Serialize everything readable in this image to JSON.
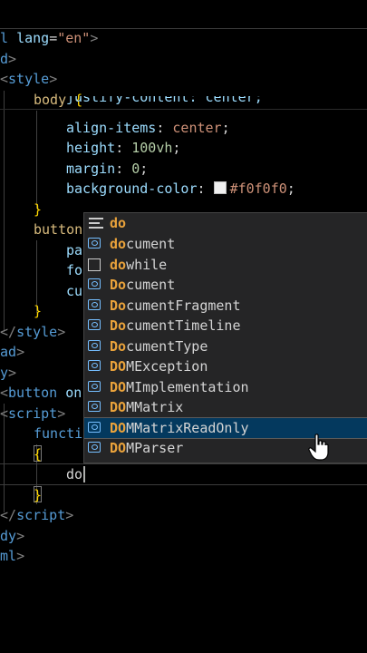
{
  "code": {
    "l1": {
      "a": "l",
      "b": "lang",
      "c": "=",
      "d": "\"en\"",
      "e": ">"
    },
    "l2": {
      "a": "d",
      "b": ">"
    },
    "l3": {
      "a": "<",
      "b": "style",
      "c": ">"
    },
    "l4": {
      "a": "body",
      "b": " {"
    },
    "l5": {
      "a": "justify-content: center;"
    },
    "l6": {
      "a": "align-items",
      "b": ": ",
      "c": "center",
      "d": ";"
    },
    "l7": {
      "a": "height",
      "b": ": ",
      "c": "100vh",
      "d": ";"
    },
    "l8": {
      "a": "margin",
      "b": ": ",
      "c": "0",
      "d": ";"
    },
    "l9": {
      "a": "background-color",
      "b": ": ",
      "c": "#f0f0f0",
      "d": ";"
    },
    "l10": {
      "a": "}"
    },
    "l11": {
      "a": "button"
    },
    "l12": {
      "a": "pa"
    },
    "l13": {
      "a": "fo"
    },
    "l14": {
      "a": "cu"
    },
    "l15": {
      "a": "}"
    },
    "l16": {
      "a": "</",
      "b": "style",
      "c": ">"
    },
    "l17": {
      "a": "ad",
      "b": ">"
    },
    "l18": {
      "a": "y",
      "b": ">"
    },
    "l19": {
      "a": "<",
      "b": "button",
      "c": " on"
    },
    "l20": {
      "a": "<",
      "b": "script",
      "c": ">"
    },
    "l21": {
      "a": "functi"
    },
    "l22": {
      "a": "{"
    },
    "l23": {
      "a": "do"
    },
    "l24": {
      "a": "}"
    },
    "l25": {
      "a": "</",
      "b": "script",
      "c": ">"
    },
    "l26": {
      "a": "dy",
      "b": ">"
    },
    "l27": {
      "a": "ml",
      "b": ">"
    }
  },
  "suggest": {
    "query": "do",
    "items": [
      {
        "match": "do",
        "rest": "cument",
        "kind": "variable-icon"
      },
      {
        "match": "do",
        "rest": "while",
        "kind": "snippet-icon"
      },
      {
        "match": "Do",
        "rest": "cument",
        "kind": "variable-icon"
      },
      {
        "match": "Do",
        "rest": "cumentFragment",
        "kind": "variable-icon"
      },
      {
        "match": "Do",
        "rest": "cumentTimeline",
        "kind": "variable-icon"
      },
      {
        "match": "Do",
        "rest": "cumentType",
        "kind": "variable-icon"
      },
      {
        "match": "DO",
        "rest": "MException",
        "kind": "variable-icon"
      },
      {
        "match": "DO",
        "rest": "MImplementation",
        "kind": "variable-icon"
      },
      {
        "match": "DO",
        "rest": "MMatrix",
        "kind": "variable-icon"
      },
      {
        "match": "DO",
        "rest": "MMatrixReadOnly",
        "kind": "variable-icon"
      },
      {
        "match": "DO",
        "rest": "MParser",
        "kind": "variable-icon"
      }
    ],
    "active_index": 9
  },
  "colors": {
    "background": "#000000",
    "widget": "#252526",
    "match": "#e9a23b",
    "active": "#04395e"
  }
}
